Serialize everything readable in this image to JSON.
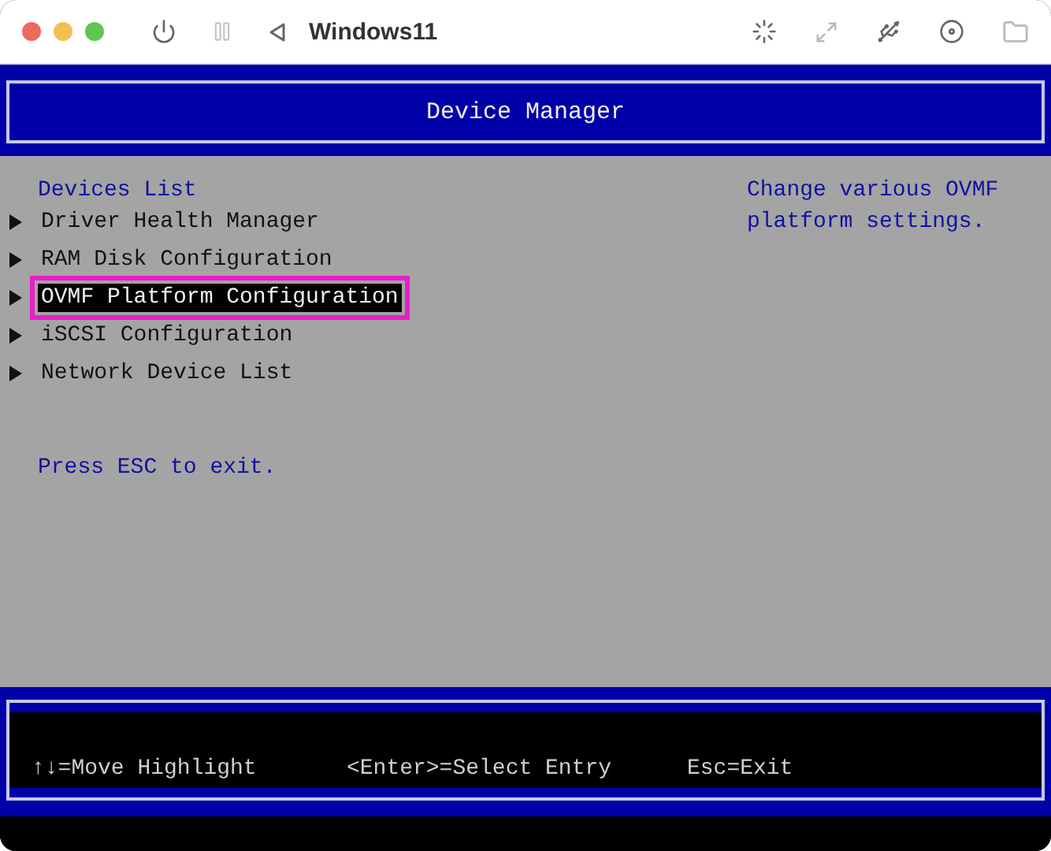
{
  "window": {
    "title": "Windows11"
  },
  "header": {
    "title": "Device Manager"
  },
  "devices": {
    "heading": "Devices List",
    "items": [
      {
        "label": "Driver Health Manager",
        "selected": false
      },
      {
        "label": "RAM Disk Configuration",
        "selected": false
      },
      {
        "label": "OVMF Platform Configuration",
        "selected": true
      },
      {
        "label": "iSCSI Configuration",
        "selected": false
      },
      {
        "label": "Network Device List",
        "selected": false
      }
    ],
    "hint": "Press ESC to exit."
  },
  "help": {
    "text": "Change various OVMF platform settings."
  },
  "footer": {
    "keys": [
      "↑↓=Move Highlight",
      "<Enter>=Select Entry",
      "Esc=Exit"
    ]
  }
}
